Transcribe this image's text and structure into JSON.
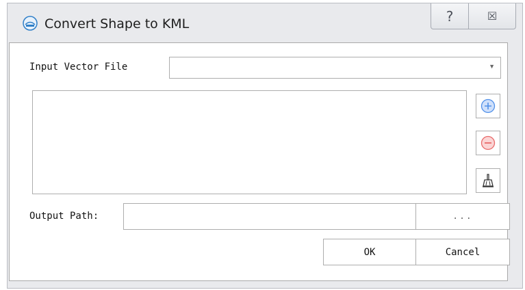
{
  "window": {
    "title": "Convert Shape to KML",
    "help_glyph": "?",
    "close_glyph": "☒"
  },
  "form": {
    "input_vector_label": "Input Vector File",
    "input_vector_value": "",
    "combo_arrow": "▼",
    "output_path_label": "Output Path:",
    "output_path_value": "",
    "browse_label": "...",
    "ok_label": "OK",
    "cancel_label": "Cancel"
  },
  "icons": {
    "app": "app-logo-icon",
    "add": "add-circle-icon",
    "remove": "remove-circle-icon",
    "clear": "broom-icon"
  },
  "colors": {
    "add_blue": "#4f8fe8",
    "remove_red": "#e86a6a"
  }
}
